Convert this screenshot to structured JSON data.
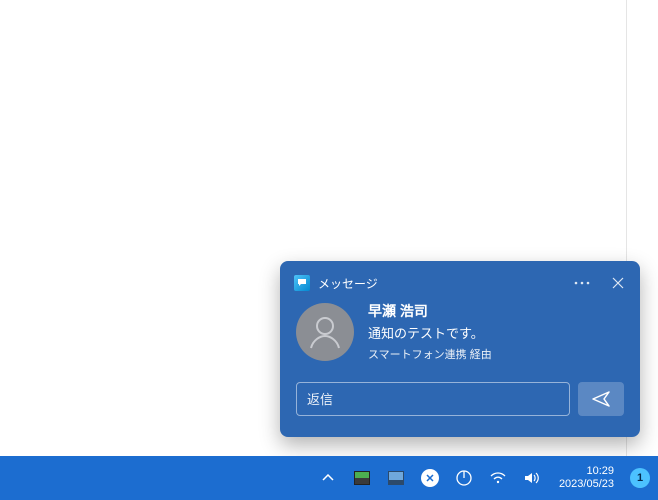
{
  "notification": {
    "app_name": "メッセージ",
    "sender": "早瀬 浩司",
    "preview": "通知のテストです。",
    "via": "スマートフォン連携 経由",
    "reply_placeholder": "返信"
  },
  "taskbar": {
    "time": "10:29",
    "date": "2023/05/23",
    "badge_count": "1"
  }
}
